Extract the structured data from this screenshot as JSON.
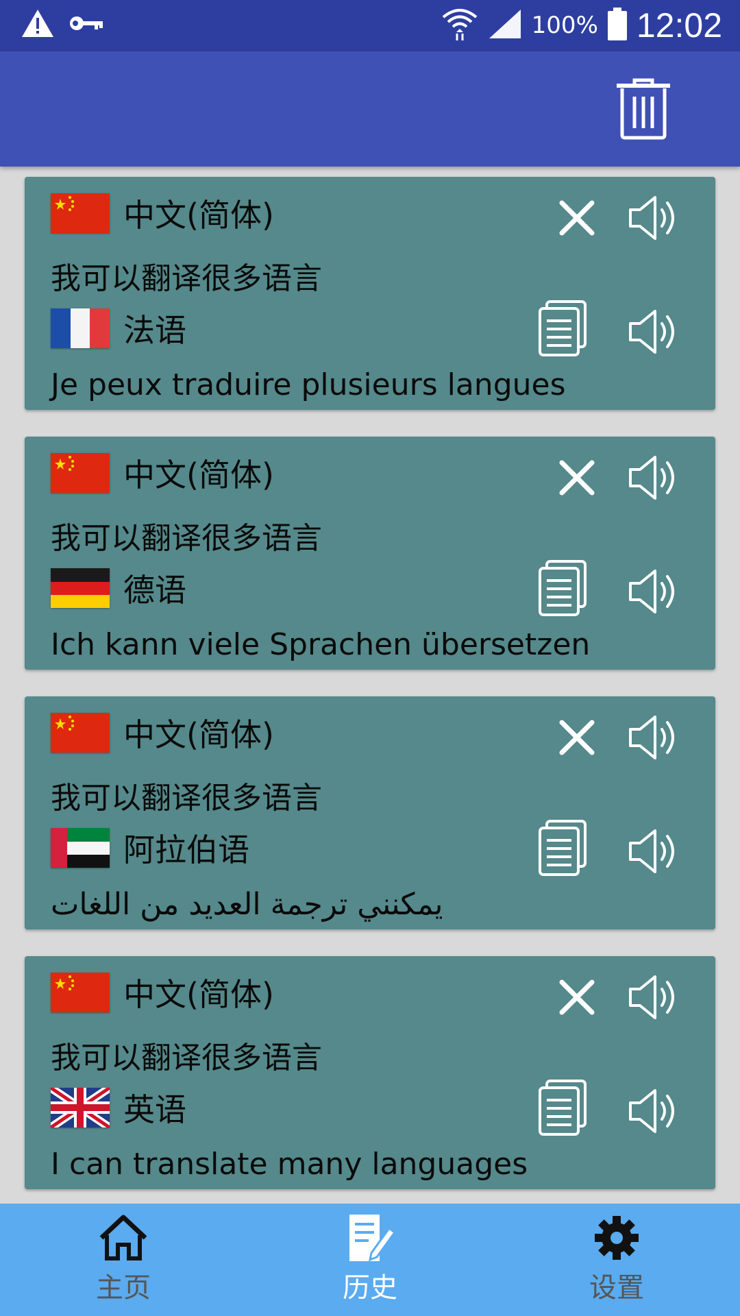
{
  "status_bar": {
    "battery_pct": "100%",
    "time": "12:02",
    "icons": [
      "warning-icon",
      "key-icon",
      "wifi-icon",
      "signal-icon",
      "battery-icon"
    ]
  },
  "app_bar": {
    "actions": [
      "trash-icon"
    ]
  },
  "history": [
    {
      "source_lang": "中文(简体)",
      "source_flag": "flag-cn",
      "source_text": "我可以翻译很多语言",
      "target_lang": "法语",
      "target_flag": "flag-fr",
      "target_text": "Je peux traduire plusieurs langues"
    },
    {
      "source_lang": "中文(简体)",
      "source_flag": "flag-cn",
      "source_text": "我可以翻译很多语言",
      "target_lang": "德语",
      "target_flag": "flag-de",
      "target_text": "Ich kann viele Sprachen übersetzen"
    },
    {
      "source_lang": "中文(简体)",
      "source_flag": "flag-cn",
      "source_text": "我可以翻译很多语言",
      "target_lang": "阿拉伯语",
      "target_flag": "flag-ae",
      "target_text": "يمكنني ترجمة العديد من اللغات"
    },
    {
      "source_lang": "中文(简体)",
      "source_flag": "flag-cn",
      "source_text": "我可以翻译很多语言",
      "target_lang": "英语",
      "target_flag": "flag-gb",
      "target_text": "I can translate many languages"
    }
  ],
  "bottom_nav": {
    "home": "主页",
    "history": "历史",
    "settings": "设置",
    "active": "history"
  },
  "colors": {
    "status_bar": "#2e3ea0",
    "app_bar": "#3f51b5",
    "card": "#55898b",
    "background": "#d9d9d9",
    "bottom_nav": "#5aabf0"
  }
}
